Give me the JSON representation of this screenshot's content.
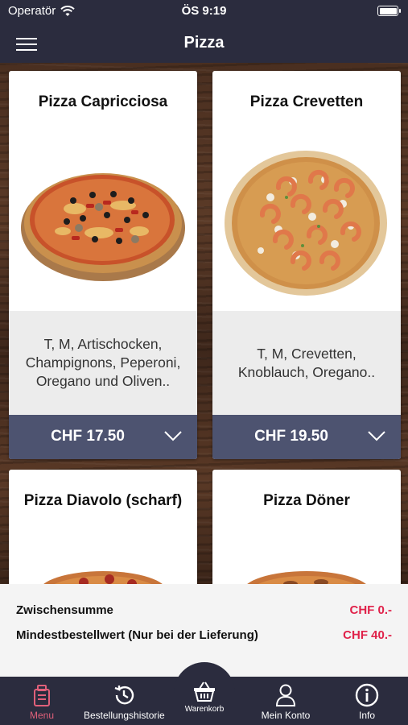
{
  "status_bar": {
    "carrier": "Operatör",
    "time": "ÖS 9:19"
  },
  "header": {
    "title": "Pizza"
  },
  "products": [
    {
      "name": "Pizza Capricciosa",
      "description": "T, M, Artischocken, Champignons, Peperoni, Oregano und Oliven..",
      "price": "CHF 17.50"
    },
    {
      "name": "Pizza Crevetten",
      "description": "T, M, Crevetten, Knoblauch, Oregano..",
      "price": "CHF 19.50"
    },
    {
      "name": "Pizza Diavolo (scharf)"
    },
    {
      "name": "Pizza Döner"
    }
  ],
  "summary": {
    "subtotal_label": "Zwischensumme",
    "subtotal_value": "CHF 0.-",
    "minimum_label": "Mindestbestellwert (Nur bei der Lieferung)",
    "minimum_value": "CHF 40.-"
  },
  "tabs": [
    {
      "label": "Menu",
      "icon": "menu-card-icon",
      "active": true
    },
    {
      "label": "Bestellungshistorie",
      "icon": "history-icon"
    },
    {
      "label": "Warenkorb",
      "icon": "basket-icon"
    },
    {
      "label": "Mein Konto",
      "icon": "user-icon"
    },
    {
      "label": "Info",
      "icon": "info-icon"
    }
  ],
  "colors": {
    "header_bg": "#2b2c3e",
    "price_bar": "#4d5370",
    "accent_red": "#e0224a",
    "active_tab": "#e0607a"
  }
}
